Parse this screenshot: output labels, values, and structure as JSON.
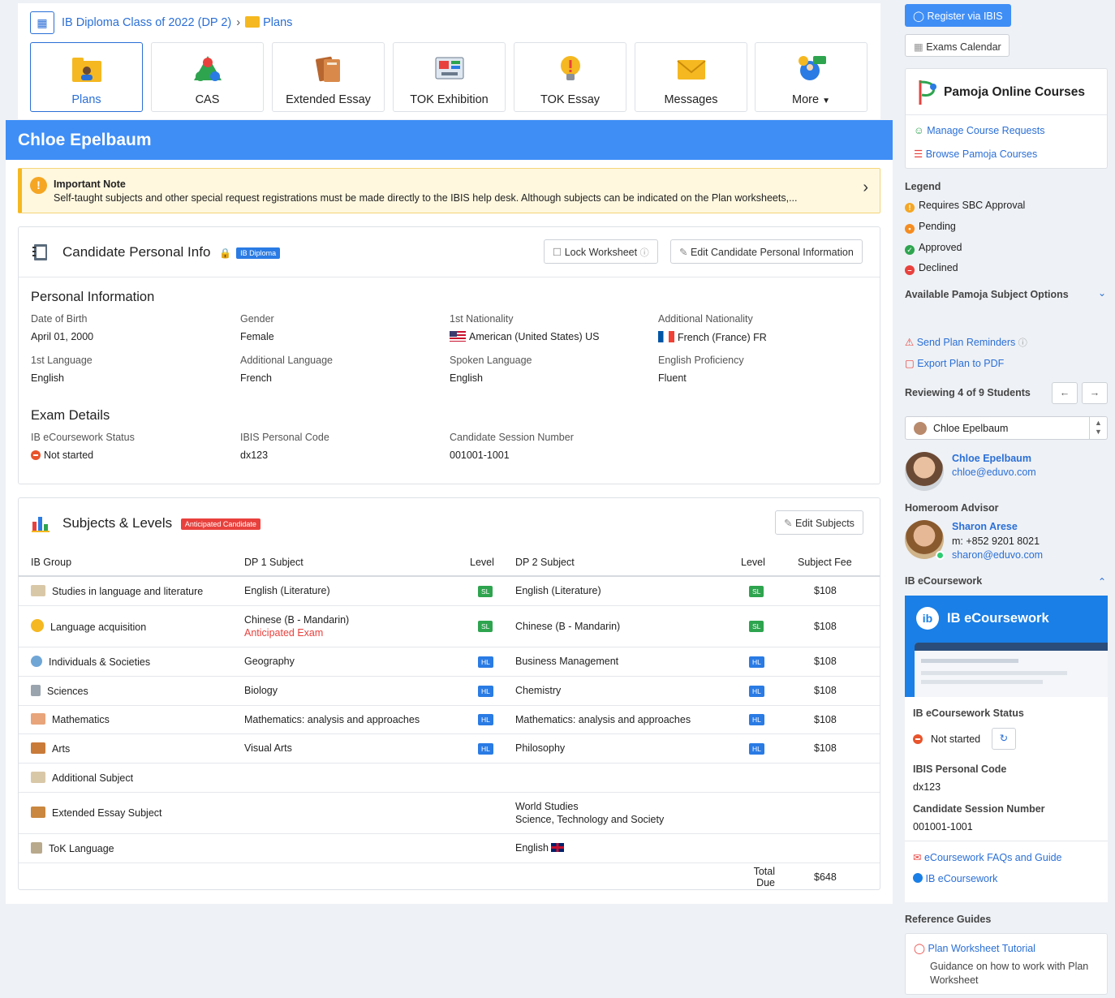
{
  "breadcrumb": {
    "class": "IB Diploma Class of 2022 (DP 2)",
    "page": "Plans"
  },
  "nav": [
    {
      "label": "Plans",
      "icon": "folder-user-icon",
      "active": true
    },
    {
      "label": "CAS",
      "icon": "cas-triangle-icon"
    },
    {
      "label": "Extended Essay",
      "icon": "books-icon"
    },
    {
      "label": "TOK Exhibition",
      "icon": "exhibition-icon"
    },
    {
      "label": "TOK Essay",
      "icon": "lightbulb-icon"
    },
    {
      "label": "Messages",
      "icon": "envelope-icon"
    },
    {
      "label": "More",
      "icon": "help-chat-icon"
    }
  ],
  "student_name": "Chloe Epelbaum",
  "note": {
    "title": "Important Note",
    "body": "Self-taught subjects and other special request registrations must be made directly to the IBIS help desk. Although subjects can be indicated on the Plan worksheets,..."
  },
  "personal_card": {
    "title": "Candidate Personal Info",
    "badge": "IB Diploma",
    "lock_btn": "Lock Worksheet",
    "edit_btn": "Edit Candidate Personal Information"
  },
  "personal_info": {
    "heading": "Personal Information",
    "fields": [
      {
        "label": "Date of Birth",
        "value": "April 01, 2000"
      },
      {
        "label": "Gender",
        "value": "Female"
      },
      {
        "label": "1st Nationality",
        "value": "American (United States) US"
      },
      {
        "label": "Additional Nationality",
        "value": "French (France) FR"
      },
      {
        "label": "1st Language",
        "value": "English"
      },
      {
        "label": "Additional Language",
        "value": "French"
      },
      {
        "label": "Spoken Language",
        "value": "English"
      },
      {
        "label": "English Proficiency",
        "value": "Fluent"
      }
    ]
  },
  "exam_details": {
    "heading": "Exam Details",
    "fields": [
      {
        "label": "IB eCoursework Status",
        "value": "Not started"
      },
      {
        "label": "IBIS Personal Code",
        "value": "dx123"
      },
      {
        "label": "Candidate Session Number",
        "value": "001001-1001"
      }
    ]
  },
  "subjects_card": {
    "title": "Subjects & Levels",
    "badge": "Anticipated Candidate",
    "edit_btn": "Edit Subjects"
  },
  "table": {
    "headers": [
      "IB Group",
      "DP 1 Subject",
      "Level",
      "DP 2 Subject",
      "Level",
      "Subject Fee"
    ],
    "rows": [
      {
        "group": "Studies in language and literature",
        "dp1": "English (Literature)",
        "dp1_note": "",
        "l1": "SL",
        "dp2": "English (Literature)",
        "dp2b": "",
        "l2": "SL",
        "fee": "$108"
      },
      {
        "group": "Language acquisition",
        "dp1": "Chinese (B - Mandarin)",
        "dp1_note": "Anticipated Exam",
        "l1": "SL",
        "dp2": "Chinese (B - Mandarin)",
        "dp2b": "",
        "l2": "SL",
        "fee": "$108"
      },
      {
        "group": "Individuals & Societies",
        "dp1": "Geography",
        "dp1_note": "",
        "l1": "HL",
        "dp2": "Business Management",
        "dp2b": "",
        "l2": "HL",
        "fee": "$108"
      },
      {
        "group": "Sciences",
        "dp1": "Biology",
        "dp1_note": "",
        "l1": "HL",
        "dp2": "Chemistry",
        "dp2b": "",
        "l2": "HL",
        "fee": "$108"
      },
      {
        "group": "Mathematics",
        "dp1": "Mathematics: analysis and approaches",
        "dp1_note": "",
        "l1": "HL",
        "dp2": "Mathematics: analysis and approaches",
        "dp2b": "",
        "l2": "HL",
        "fee": "$108"
      },
      {
        "group": "Arts",
        "dp1": "Visual Arts",
        "dp1_note": "",
        "l1": "HL",
        "dp2": "Philosophy",
        "dp2b": "",
        "l2": "HL",
        "fee": "$108"
      },
      {
        "group": "Additional Subject",
        "dp1": "",
        "dp1_note": "",
        "l1": "",
        "dp2": "",
        "dp2b": "",
        "l2": "",
        "fee": ""
      },
      {
        "group": "Extended Essay Subject",
        "dp1": "",
        "dp1_note": "",
        "l1": "",
        "dp2": "World Studies",
        "dp2b": "Science, Technology and Society",
        "l2": "",
        "fee": ""
      },
      {
        "group": "ToK Language",
        "dp1": "",
        "dp1_note": "",
        "l1": "",
        "dp2": "English",
        "dp2b": "",
        "l2": "",
        "fee": ""
      }
    ],
    "total_label": "Total Due",
    "total": "$648"
  },
  "sidebar": {
    "register_btn": "Register via IBIS",
    "calendar_btn": "Exams Calendar",
    "pamoja_title": "Pamoja Online Courses",
    "pamoja_links": [
      "Manage Course Requests",
      "Browse Pamoja Courses"
    ],
    "legend_title": "Legend",
    "legend": [
      "Requires SBC Approval",
      "Pending",
      "Approved",
      "Declined"
    ],
    "pamoja_options": "Available Pamoja Subject Options",
    "actions": [
      "Send Plan Reminders",
      "Export Plan to PDF"
    ],
    "reviewing": "Reviewing 4 of 9 Students",
    "select_value": "Chloe Epelbaum",
    "student": {
      "name": "Chloe Epelbaum",
      "email": "chloe@eduvo.com"
    },
    "advisor_title": "Homeroom Advisor",
    "advisor": {
      "name": "Sharon Arese",
      "phone": "m: +852 9201 8021",
      "email": "sharon@eduvo.com"
    },
    "ecw_section": "IB eCoursework",
    "ecw_banner": "IB eCoursework",
    "ecw_status_label": "IB eCoursework Status",
    "ecw_status": "Not started",
    "ecw_code_label": "IBIS Personal Code",
    "ecw_code": "dx123",
    "ecw_session_label": "Candidate Session Number",
    "ecw_session": "001001-1001",
    "ecw_links": [
      "eCoursework FAQs and Guide",
      "IB eCoursework"
    ],
    "ref_title": "Reference Guides",
    "ref_link": "Plan Worksheet Tutorial",
    "ref_desc": "Guidance on how to work with Plan Worksheet"
  },
  "colors": {
    "accent": "#2a6fd6",
    "name_bar": "#3f8ef6",
    "sl": "#2ea44f",
    "hl": "#2a7be4",
    "anticipated": "#e8413d"
  }
}
